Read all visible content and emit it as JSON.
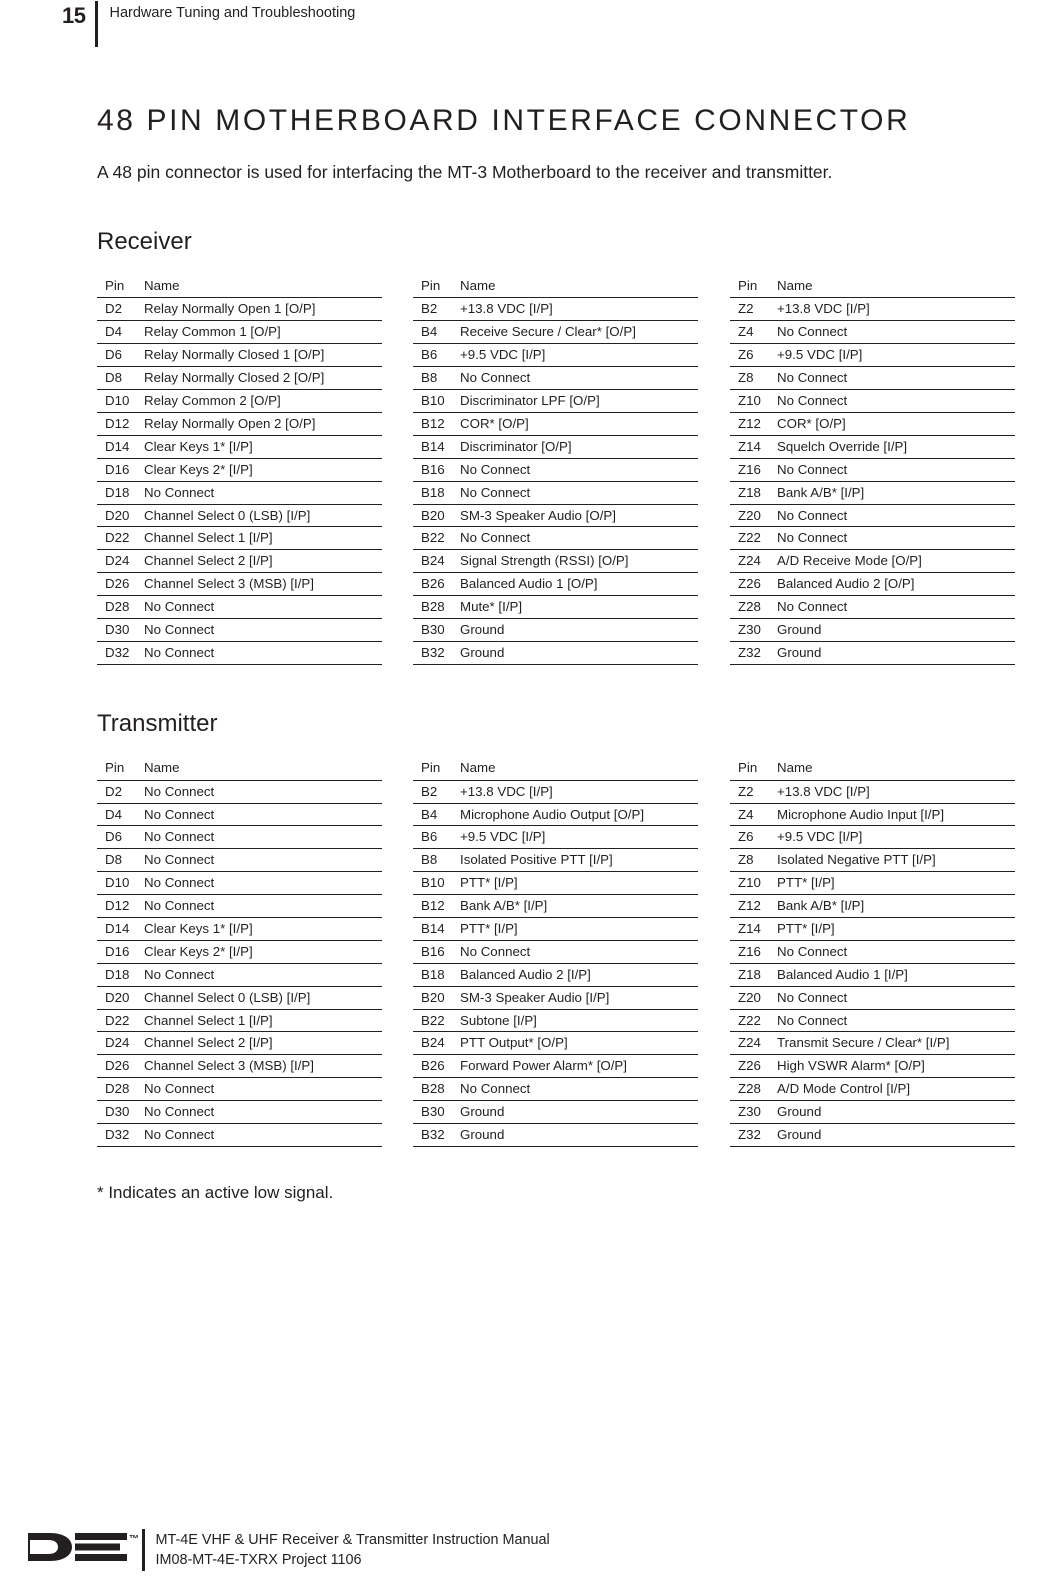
{
  "header": {
    "page_number": "15",
    "title": "Hardware Tuning and Troubleshooting"
  },
  "doc": {
    "title": "48 PIN MOTHERBOARD INTERFACE CONNECTOR",
    "intro": "A 48 pin connector is used for interfacing the MT-3 Motherboard to the receiver and transmitter.",
    "footnote": "* Indicates an active low signal."
  },
  "columns": {
    "pin": "Pin",
    "name": "Name"
  },
  "sections": [
    {
      "heading": "Receiver",
      "tables": [
        {
          "id": "receiver-d",
          "rows": [
            {
              "pin": "D2",
              "name": "Relay Normally Open 1 [O/P]"
            },
            {
              "pin": "D4",
              "name": "Relay Common 1 [O/P]"
            },
            {
              "pin": "D6",
              "name": "Relay Normally Closed 1 [O/P]"
            },
            {
              "pin": "D8",
              "name": "Relay Normally Closed 2 [O/P]"
            },
            {
              "pin": "D10",
              "name": "Relay Common 2 [O/P]"
            },
            {
              "pin": "D12",
              "name": "Relay Normally Open 2 [O/P]"
            },
            {
              "pin": "D14",
              "name": "Clear Keys 1* [I/P]"
            },
            {
              "pin": "D16",
              "name": "Clear Keys 2* [I/P]"
            },
            {
              "pin": "D18",
              "name": "No Connect"
            },
            {
              "pin": "D20",
              "name": "Channel Select 0 (LSB) [I/P]"
            },
            {
              "pin": "D22",
              "name": "Channel Select 1 [I/P]"
            },
            {
              "pin": "D24",
              "name": "Channel Select 2 [I/P]"
            },
            {
              "pin": "D26",
              "name": "Channel Select 3 (MSB) [I/P]"
            },
            {
              "pin": "D28",
              "name": "No Connect"
            },
            {
              "pin": "D30",
              "name": "No Connect"
            },
            {
              "pin": "D32",
              "name": "No Connect"
            }
          ]
        },
        {
          "id": "receiver-b",
          "rows": [
            {
              "pin": "B2",
              "name": "+13.8 VDC [I/P]"
            },
            {
              "pin": "B4",
              "name": "Receive Secure / Clear* [O/P]"
            },
            {
              "pin": "B6",
              "name": "+9.5 VDC [I/P]"
            },
            {
              "pin": "B8",
              "name": "No Connect"
            },
            {
              "pin": "B10",
              "name": "Discriminator LPF [O/P]"
            },
            {
              "pin": "B12",
              "name": "COR* [O/P]"
            },
            {
              "pin": "B14",
              "name": "Discriminator [O/P]"
            },
            {
              "pin": "B16",
              "name": "No Connect"
            },
            {
              "pin": "B18",
              "name": "No Connect"
            },
            {
              "pin": "B20",
              "name": "SM-3 Speaker Audio [O/P]"
            },
            {
              "pin": "B22",
              "name": "No Connect"
            },
            {
              "pin": "B24",
              "name": "Signal Strength (RSSI) [O/P]"
            },
            {
              "pin": "B26",
              "name": "Balanced Audio 1 [O/P]"
            },
            {
              "pin": "B28",
              "name": "Mute* [I/P]"
            },
            {
              "pin": "B30",
              "name": "Ground"
            },
            {
              "pin": "B32",
              "name": "Ground"
            }
          ]
        },
        {
          "id": "receiver-z",
          "rows": [
            {
              "pin": "Z2",
              "name": "+13.8 VDC [I/P]"
            },
            {
              "pin": "Z4",
              "name": "No Connect"
            },
            {
              "pin": "Z6",
              "name": "+9.5 VDC [I/P]"
            },
            {
              "pin": "Z8",
              "name": "No Connect"
            },
            {
              "pin": "Z10",
              "name": "No Connect"
            },
            {
              "pin": "Z12",
              "name": "COR* [O/P]"
            },
            {
              "pin": "Z14",
              "name": "Squelch Override [I/P]"
            },
            {
              "pin": "Z16",
              "name": "No Connect"
            },
            {
              "pin": "Z18",
              "name": "Bank A/B* [I/P]"
            },
            {
              "pin": "Z20",
              "name": "No Connect"
            },
            {
              "pin": "Z22",
              "name": "No Connect"
            },
            {
              "pin": "Z24",
              "name": "A/D Receive Mode [O/P]"
            },
            {
              "pin": "Z26",
              "name": "Balanced Audio 2 [O/P]"
            },
            {
              "pin": "Z28",
              "name": "No Connect"
            },
            {
              "pin": "Z30",
              "name": "Ground"
            },
            {
              "pin": "Z32",
              "name": "Ground"
            }
          ]
        }
      ]
    },
    {
      "heading": "Transmitter",
      "tables": [
        {
          "id": "transmitter-d",
          "rows": [
            {
              "pin": "D2",
              "name": "No Connect"
            },
            {
              "pin": "D4",
              "name": "No Connect"
            },
            {
              "pin": "D6",
              "name": "No Connect"
            },
            {
              "pin": "D8",
              "name": "No Connect"
            },
            {
              "pin": "D10",
              "name": "No Connect"
            },
            {
              "pin": "D12",
              "name": "No Connect"
            },
            {
              "pin": "D14",
              "name": "Clear Keys 1* [I/P]"
            },
            {
              "pin": "D16",
              "name": "Clear Keys 2* [I/P]"
            },
            {
              "pin": "D18",
              "name": "No Connect"
            },
            {
              "pin": "D20",
              "name": "Channel Select 0 (LSB) [I/P]"
            },
            {
              "pin": "D22",
              "name": "Channel Select 1 [I/P]"
            },
            {
              "pin": "D24",
              "name": "Channel Select 2 [I/P]"
            },
            {
              "pin": "D26",
              "name": "Channel Select 3 (MSB) [I/P]"
            },
            {
              "pin": "D28",
              "name": "No Connect"
            },
            {
              "pin": "D30",
              "name": "No Connect"
            },
            {
              "pin": "D32",
              "name": "No Connect"
            }
          ]
        },
        {
          "id": "transmitter-b",
          "rows": [
            {
              "pin": "B2",
              "name": "+13.8 VDC [I/P]"
            },
            {
              "pin": "B4",
              "name": "Microphone Audio Output [O/P]"
            },
            {
              "pin": "B6",
              "name": "+9.5 VDC [I/P]"
            },
            {
              "pin": "B8",
              "name": "Isolated Positive PTT [I/P]"
            },
            {
              "pin": "B10",
              "name": "PTT* [I/P]"
            },
            {
              "pin": "B12",
              "name": "Bank A/B* [I/P]"
            },
            {
              "pin": "B14",
              "name": "PTT* [I/P]"
            },
            {
              "pin": "B16",
              "name": "No Connect"
            },
            {
              "pin": "B18",
              "name": "Balanced Audio 2 [I/P]"
            },
            {
              "pin": "B20",
              "name": "SM-3 Speaker Audio [I/P]"
            },
            {
              "pin": "B22",
              "name": "Subtone [I/P]"
            },
            {
              "pin": "B24",
              "name": "PTT Output* [O/P]"
            },
            {
              "pin": "B26",
              "name": "Forward Power Alarm* [O/P]"
            },
            {
              "pin": "B28",
              "name": "No Connect"
            },
            {
              "pin": "B30",
              "name": "Ground"
            },
            {
              "pin": "B32",
              "name": "Ground"
            }
          ]
        },
        {
          "id": "transmitter-z",
          "rows": [
            {
              "pin": "Z2",
              "name": "+13.8 VDC [I/P]"
            },
            {
              "pin": "Z4",
              "name": "Microphone Audio Input [I/P]"
            },
            {
              "pin": "Z6",
              "name": "+9.5 VDC [I/P]"
            },
            {
              "pin": "Z8",
              "name": "Isolated Negative PTT [I/P]"
            },
            {
              "pin": "Z10",
              "name": "PTT* [I/P]"
            },
            {
              "pin": "Z12",
              "name": "Bank A/B* [I/P]"
            },
            {
              "pin": "Z14",
              "name": "PTT* [I/P]"
            },
            {
              "pin": "Z16",
              "name": "No Connect"
            },
            {
              "pin": "Z18",
              "name": "Balanced Audio 1 [I/P]"
            },
            {
              "pin": "Z20",
              "name": "No Connect"
            },
            {
              "pin": "Z22",
              "name": "No Connect"
            },
            {
              "pin": "Z24",
              "name": "Transmit Secure / Clear* [I/P]"
            },
            {
              "pin": "Z26",
              "name": "High VSWR Alarm* [O/P]"
            },
            {
              "pin": "Z28",
              "name": "A/D Mode Control [I/P]"
            },
            {
              "pin": "Z30",
              "name": "Ground"
            },
            {
              "pin": "Z32",
              "name": "Ground"
            }
          ]
        }
      ]
    }
  ],
  "footer": {
    "logo_mark": "de-logo",
    "trademark": "™",
    "line1": "MT-4E VHF & UHF Receiver & Transmitter Instruction Manual",
    "line2": "IM08-MT-4E-TXRX Project 1106"
  }
}
